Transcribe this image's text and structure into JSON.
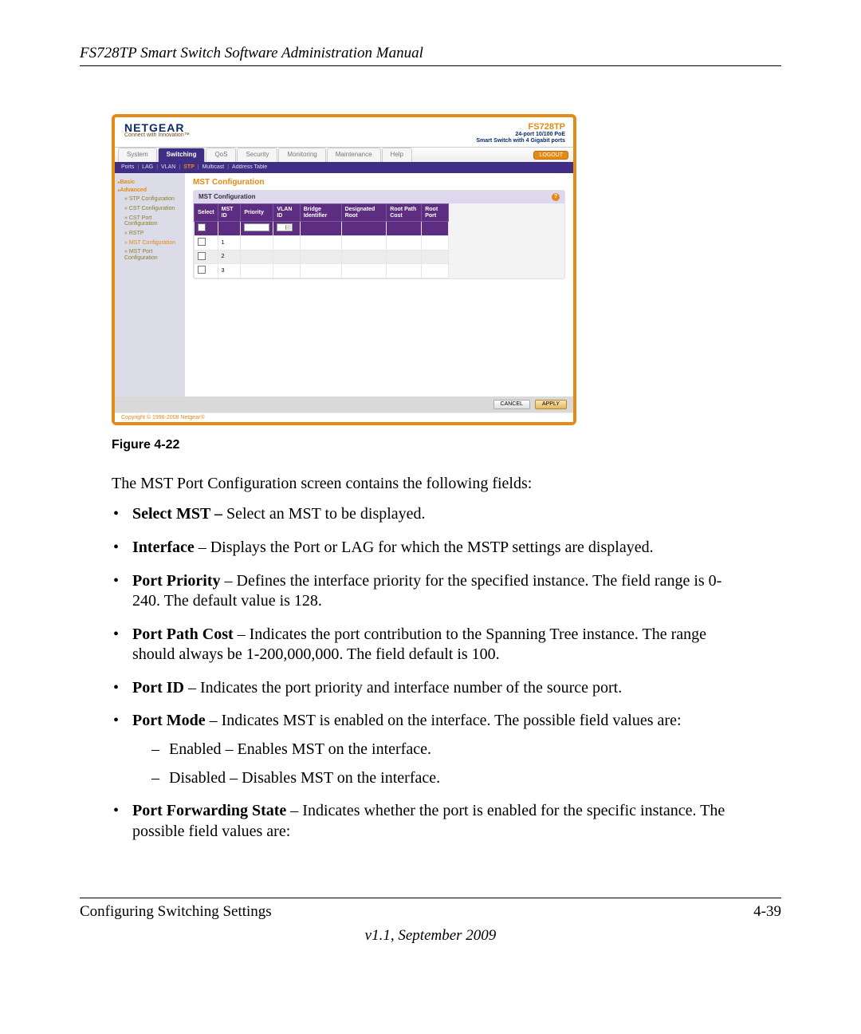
{
  "doc": {
    "header": "FS728TP Smart Switch Software Administration Manual",
    "footer_left": "Configuring Switching Settings",
    "footer_right": "4-39",
    "version": "v1.1, September 2009",
    "figure_caption": "Figure 4-22",
    "lead": "The MST Port Configuration screen contains the following fields:"
  },
  "bullets": [
    {
      "term": "Select MST –",
      "desc": " Select an MST to be displayed."
    },
    {
      "term": "Interface",
      "desc": " – Displays the Port or LAG for which the MSTP settings are displayed."
    },
    {
      "term": "Port Priority",
      "desc": " – Defines the interface priority for the specified instance. The field range is 0-240. The default value is 128."
    },
    {
      "term": "Port Path Cost",
      "desc": " – Indicates the port contribution to the Spanning Tree instance. The range should always be 1-200,000,000. The field default is 100."
    },
    {
      "term": "Port ID",
      "desc": " – Indicates the port priority and interface number of the source port."
    },
    {
      "term": "Port Mode",
      "desc": " – Indicates MST is enabled on the interface. The possible field values are:",
      "sub": [
        "Enabled – Enables MST on the interface.",
        "Disabled – Disables MST on the interface."
      ]
    },
    {
      "term": "Port Forwarding State",
      "desc": " – Indicates whether the port is enabled for the specific instance. The possible field values are:"
    }
  ],
  "app": {
    "brand": "NETGEAR",
    "brand_sub": "Connect with Innovation™",
    "model": "FS728TP",
    "model_sub1": "24-port 10/100 PoE",
    "model_sub2": "Smart Switch with 4 Gigabit ports",
    "logout": "LOGOUT",
    "tabs": [
      "System",
      "Switching",
      "QoS",
      "Security",
      "Monitoring",
      "Maintenance",
      "Help"
    ],
    "active_tab": 1,
    "subtabs": [
      "Ports",
      "LAG",
      "VLAN",
      "STP",
      "Multicast",
      "Address Table"
    ],
    "active_subtab": 3,
    "side": {
      "basic": "Basic",
      "advanced": "Advanced",
      "items": [
        "STP Configuration",
        "CST Configuration",
        "CST Port Configuration",
        "RSTP",
        "MST Configuration",
        "MST Port Configuration"
      ],
      "active_item": 4
    },
    "section_title": "MST Configuration",
    "table_title": "MST Configuration",
    "columns": [
      "Select",
      "MST ID",
      "Priority",
      "VLAN ID",
      "Bridge Identifier",
      "Designated Root",
      "Root Path Cost",
      "Root Port"
    ],
    "rows": [
      {
        "mst_id": "1"
      },
      {
        "mst_id": "2"
      },
      {
        "mst_id": "3"
      }
    ],
    "cancel": "CANCEL",
    "apply": "APPLY",
    "copyright": "Copyright © 1996-2008 Netgear®"
  }
}
